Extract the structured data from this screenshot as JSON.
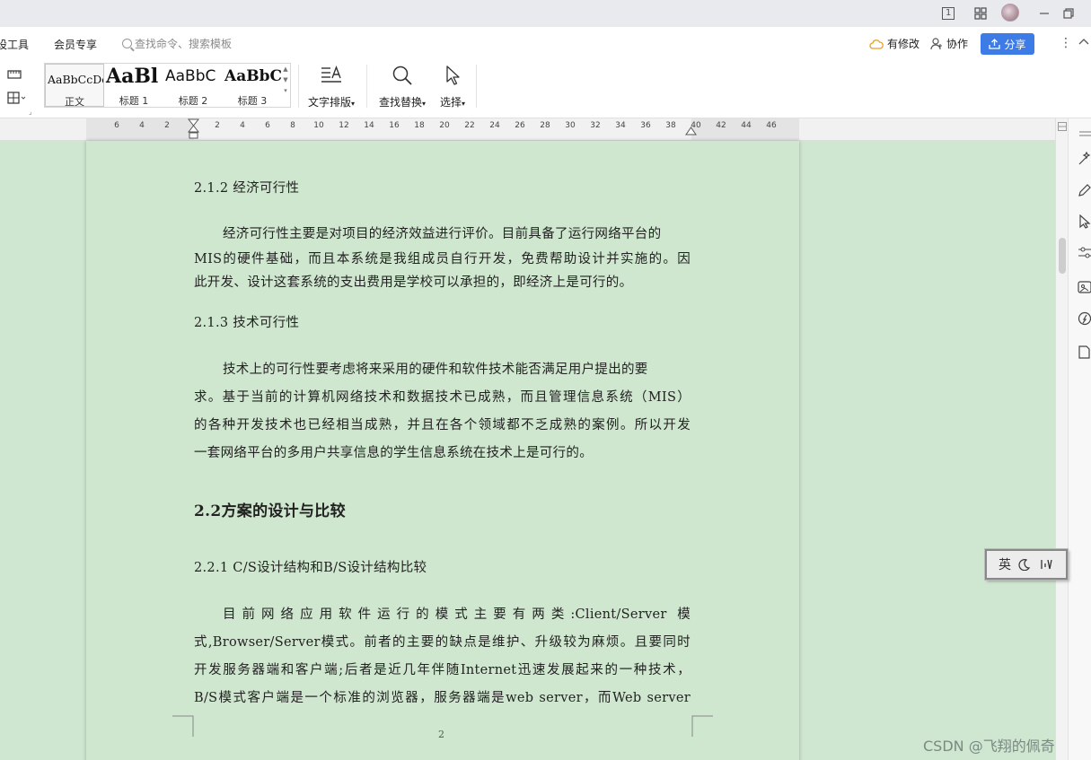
{
  "titlebar": {
    "page_indicator": "1"
  },
  "menubar": {
    "items": [
      "设工具",
      "会员专享"
    ],
    "search_placeholder": "查找命令、搜索模板",
    "modified_label": "有修改",
    "collab_label": "协作",
    "share_label": "分享"
  },
  "ribbon": {
    "styles": [
      {
        "sample": "AaBbCcDd",
        "name": "正文"
      },
      {
        "sample": "AaBl",
        "name": "标题 1"
      },
      {
        "sample": "AaBbC",
        "name": "标题 2"
      },
      {
        "sample": "AaBbC",
        "name": "标题 3"
      }
    ],
    "text_layout_label": "文字排版",
    "find_replace_label": "查找替换",
    "select_label": "选择"
  },
  "ruler": {
    "ticks": [
      "6",
      "4",
      "2",
      "2",
      "4",
      "6",
      "8",
      "10",
      "12",
      "14",
      "16",
      "18",
      "20",
      "22",
      "24",
      "26",
      "28",
      "30",
      "32",
      "34",
      "36",
      "38",
      "40",
      "42",
      "44",
      "46"
    ]
  },
  "document": {
    "lines": [
      "2.1.2 经济可行性",
      "经济可行性主要是对项目的经济效益进行评价。目前具备了运行网络平台的",
      "MIS的硬件基础，而且本系统是我组成员自行开发，免费帮助设计并实施的。因",
      "此开发、设计这套系统的支出费用是学校可以承担的，即经济上是可行的。",
      "2.1.3 技术可行性",
      "技术上的可行性要考虑将来采用的硬件和软件技术能否满足用户提出的要",
      "求。基于当前的计算机网络技术和数据技术已成熟，而且管理信息系统（MIS）",
      "的各种开发技术也已经相当成熟，并且在各个领域都不乏成熟的案例。所以开发",
      "一套网络平台的多用户共享信息的学生信息系统在技术上是可行的。",
      "2.2方案的设计与比较",
      "2.2.1 C/S设计结构和B/S设计结构比较",
      "目前网络应用软件运行的模式主要有两类:Client/Server 模",
      "式,Browser/Server模式。前者的主要的缺点是维护、升级较为麻烦。且要同时",
      "开发服务器端和客户端;后者是近几年伴随Internet迅速发展起来的一种技术，",
      "B/S模式客户端是一个标准的浏览器，服务器端是web server，而Web server"
    ],
    "page_number": "2"
  },
  "ime": {
    "mode": "英"
  },
  "watermark": "CSDN @飞翔的佩奇",
  "colors": {
    "accent": "#3d7be6",
    "page_bg": "#cfe6cf"
  }
}
